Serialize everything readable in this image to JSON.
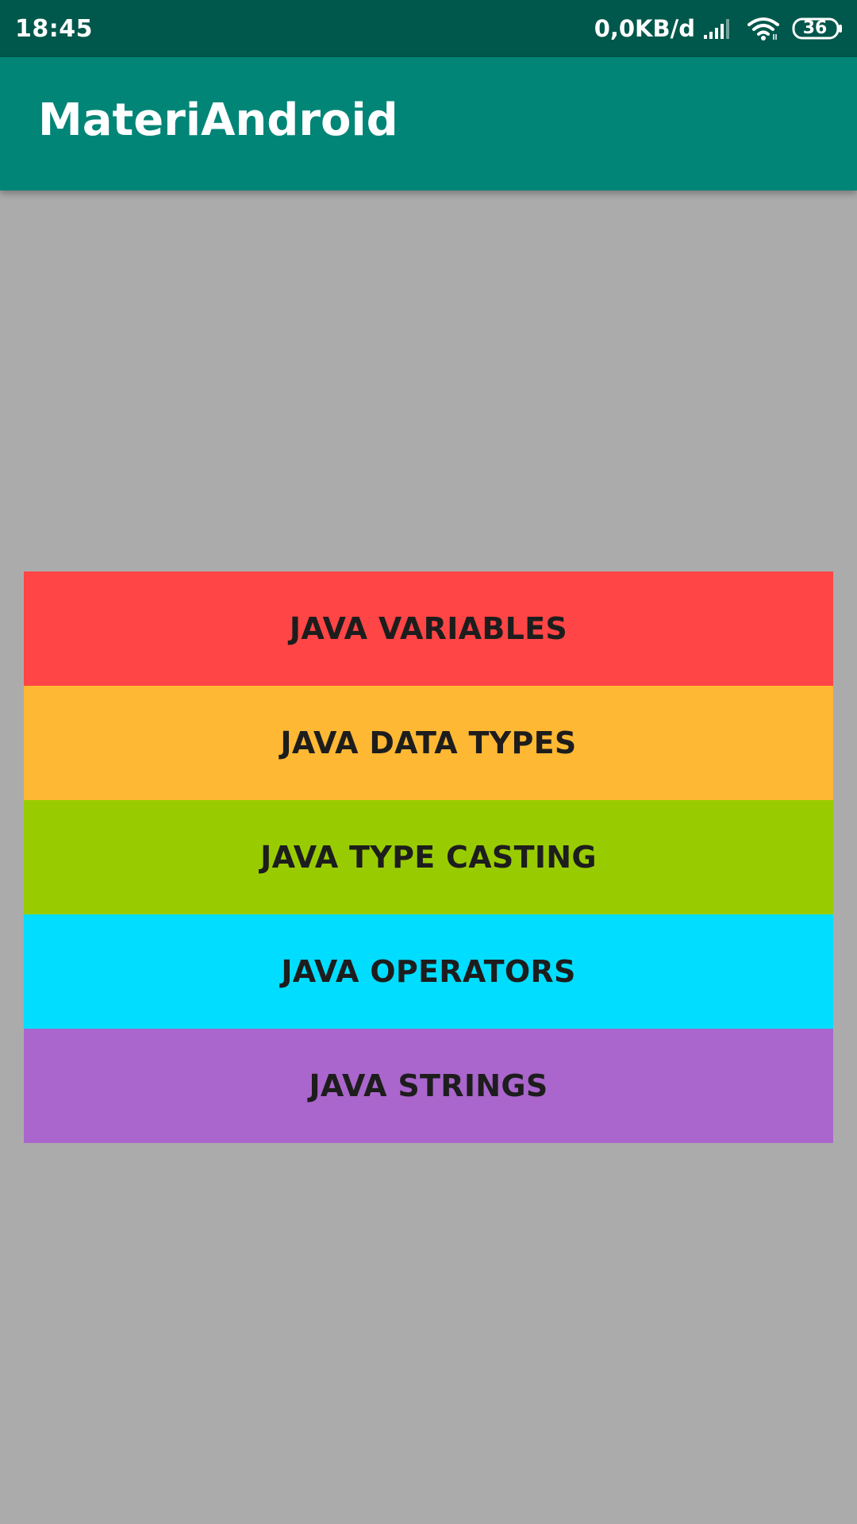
{
  "status_bar": {
    "time": "18:45",
    "network_speed": "0,0KB/d",
    "battery_level": "36",
    "icons": [
      "signal-icon",
      "wifi-icon",
      "battery-icon"
    ]
  },
  "app_bar": {
    "title": "MateriAndroid",
    "color": "#008577"
  },
  "menu": {
    "items": [
      {
        "label": "JAVA VARIABLES",
        "color": "#ff4545"
      },
      {
        "label": "JAVA DATA TYPES",
        "color": "#ffb833"
      },
      {
        "label": "JAVA TYPE CASTING",
        "color": "#99cc00"
      },
      {
        "label": "JAVA OPERATORS",
        "color": "#00ddff"
      },
      {
        "label": "JAVA STRINGS",
        "color": "#aa66cc"
      }
    ]
  },
  "colors": {
    "status_bar": "#00574b",
    "background": "#ababab"
  }
}
